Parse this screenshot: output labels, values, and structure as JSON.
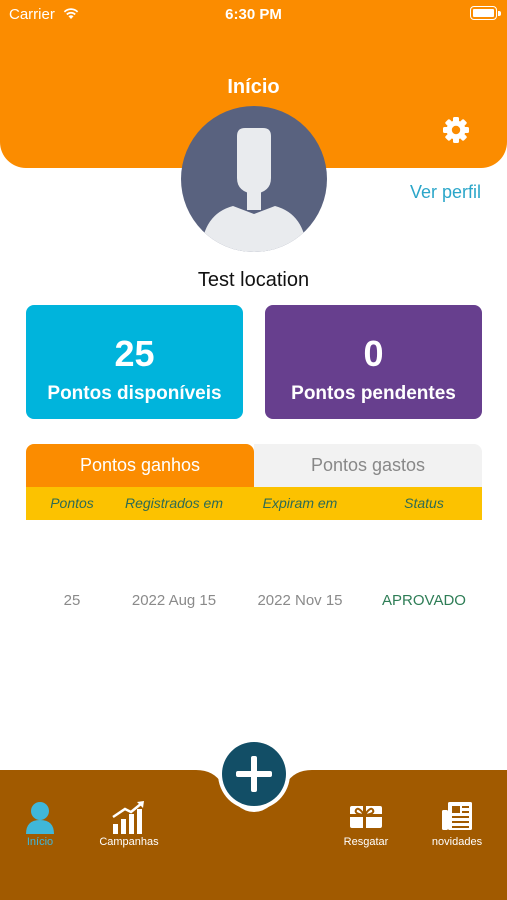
{
  "status_bar": {
    "carrier": "Carrier",
    "time": "6:30 PM"
  },
  "header": {
    "title": "Início"
  },
  "profile": {
    "view_profile": "Ver perfil",
    "location": "Test location"
  },
  "points": {
    "available": {
      "value": "25",
      "label": "Pontos disponíveis"
    },
    "pending": {
      "value": "0",
      "label": "Pontos pendentes"
    }
  },
  "tabs": [
    {
      "label": "Pontos ganhos",
      "active": true
    },
    {
      "label": "Pontos gastos",
      "active": false
    }
  ],
  "table": {
    "headers": [
      "Pontos",
      "Registrados em",
      "Expiram em",
      "Status"
    ],
    "rows": [
      [
        "25",
        "2022 Aug 15",
        "2022 Nov 15",
        "APROVADO"
      ]
    ]
  },
  "nav": {
    "items": [
      {
        "label": "Início",
        "icon": "user-icon",
        "active": true
      },
      {
        "label": "Campanhas",
        "icon": "chart-growth-icon",
        "active": false
      },
      {
        "label": "Resgatar",
        "icon": "gift-card-icon",
        "active": false
      },
      {
        "label": "novidades",
        "icon": "news-icon",
        "active": false
      }
    ],
    "fab_icon": "plus-icon"
  },
  "colors": {
    "accent": "#fb8c00",
    "points_available": "#00b4dc",
    "points_pending": "#673f8e",
    "table_header": "#fcc200",
    "nav_background": "#a15a00",
    "status_approved": "#2e7d56"
  }
}
